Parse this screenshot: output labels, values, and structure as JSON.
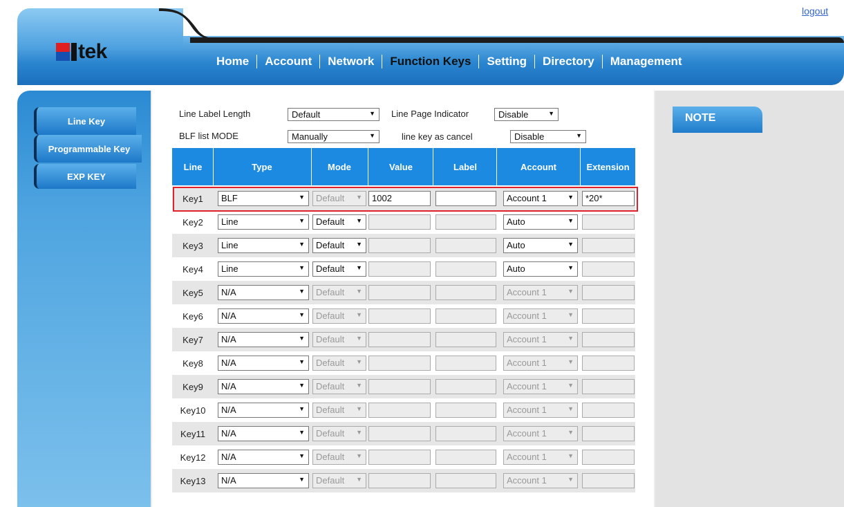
{
  "header": {
    "logo_text": "tek",
    "logout": "logout",
    "nav": [
      {
        "label": "Home",
        "active": false
      },
      {
        "label": "Account",
        "active": false
      },
      {
        "label": "Network",
        "active": false
      },
      {
        "label": "Function Keys",
        "active": true
      },
      {
        "label": "Setting",
        "active": false
      },
      {
        "label": "Directory",
        "active": false
      },
      {
        "label": "Management",
        "active": false
      }
    ]
  },
  "sidebar": {
    "items": [
      "Line Key",
      "Programmable Key",
      "EXP KEY"
    ]
  },
  "settings": {
    "line_label_length": {
      "label": "Line Label Length",
      "value": "Default"
    },
    "line_page_indicator": {
      "label": "Line Page Indicator",
      "value": "Disable"
    },
    "blf_list_mode": {
      "label": "BLF list MODE",
      "value": "Manually"
    },
    "line_key_as_cancel": {
      "label": "line key as cancel",
      "value": "Disable"
    }
  },
  "table": {
    "headers": [
      "Line",
      "Type",
      "Mode",
      "Value",
      "Label",
      "Account",
      "Extension"
    ],
    "rows": [
      {
        "key": "Key1",
        "type": "BLF",
        "mode": "Default",
        "value": "1002",
        "label": "",
        "account": "Account 1",
        "extension": "*20*",
        "mode_enabled": false,
        "text_enabled": true,
        "account_enabled": true
      },
      {
        "key": "Key2",
        "type": "Line",
        "mode": "Default",
        "value": "",
        "label": "",
        "account": "Auto",
        "extension": "",
        "mode_enabled": true,
        "text_enabled": false,
        "account_enabled": true
      },
      {
        "key": "Key3",
        "type": "Line",
        "mode": "Default",
        "value": "",
        "label": "",
        "account": "Auto",
        "extension": "",
        "mode_enabled": true,
        "text_enabled": false,
        "account_enabled": true
      },
      {
        "key": "Key4",
        "type": "Line",
        "mode": "Default",
        "value": "",
        "label": "",
        "account": "Auto",
        "extension": "",
        "mode_enabled": true,
        "text_enabled": false,
        "account_enabled": true
      },
      {
        "key": "Key5",
        "type": "N/A",
        "mode": "Default",
        "value": "",
        "label": "",
        "account": "Account 1",
        "extension": "",
        "mode_enabled": false,
        "text_enabled": false,
        "account_enabled": false
      },
      {
        "key": "Key6",
        "type": "N/A",
        "mode": "Default",
        "value": "",
        "label": "",
        "account": "Account 1",
        "extension": "",
        "mode_enabled": false,
        "text_enabled": false,
        "account_enabled": false
      },
      {
        "key": "Key7",
        "type": "N/A",
        "mode": "Default",
        "value": "",
        "label": "",
        "account": "Account 1",
        "extension": "",
        "mode_enabled": false,
        "text_enabled": false,
        "account_enabled": false
      },
      {
        "key": "Key8",
        "type": "N/A",
        "mode": "Default",
        "value": "",
        "label": "",
        "account": "Account 1",
        "extension": "",
        "mode_enabled": false,
        "text_enabled": false,
        "account_enabled": false
      },
      {
        "key": "Key9",
        "type": "N/A",
        "mode": "Default",
        "value": "",
        "label": "",
        "account": "Account 1",
        "extension": "",
        "mode_enabled": false,
        "text_enabled": false,
        "account_enabled": false
      },
      {
        "key": "Key10",
        "type": "N/A",
        "mode": "Default",
        "value": "",
        "label": "",
        "account": "Account 1",
        "extension": "",
        "mode_enabled": false,
        "text_enabled": false,
        "account_enabled": false
      },
      {
        "key": "Key11",
        "type": "N/A",
        "mode": "Default",
        "value": "",
        "label": "",
        "account": "Account 1",
        "extension": "",
        "mode_enabled": false,
        "text_enabled": false,
        "account_enabled": false
      },
      {
        "key": "Key12",
        "type": "N/A",
        "mode": "Default",
        "value": "",
        "label": "",
        "account": "Account 1",
        "extension": "",
        "mode_enabled": false,
        "text_enabled": false,
        "account_enabled": false
      },
      {
        "key": "Key13",
        "type": "N/A",
        "mode": "Default",
        "value": "",
        "label": "",
        "account": "Account 1",
        "extension": "",
        "mode_enabled": false,
        "text_enabled": false,
        "account_enabled": false
      }
    ]
  },
  "note": {
    "title": "NOTE"
  },
  "icons": {
    "dropdown": "dropdown-arrow-icon"
  }
}
